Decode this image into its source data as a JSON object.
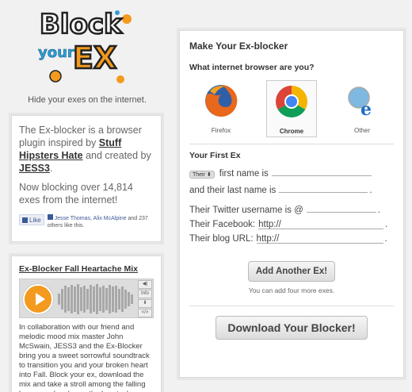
{
  "logo": {
    "line1": "Block",
    "line2": "your",
    "line3": "EX"
  },
  "tagline": "Hide your exes on the internet.",
  "info": {
    "text_before": "The Ex-blocker is a browser plugin inspired by ",
    "link1": "Stuff Hipsters Hate",
    "text_mid": " and created by ",
    "link2": "JESS3",
    "text_after": ".",
    "blocking_before": "Now blocking over ",
    "blocking_count": "14,814",
    "blocking_after": " exes from the internet!",
    "like_label": "Like",
    "like_names": "Jesse Thomas, Alix McAlpine",
    "like_rest": " and 237 others like this."
  },
  "mix": {
    "title": "Ex-Blocker Fall Heartache Mix",
    "ctrl_info": "Info",
    "ctrl_embed": "</>",
    "text": "In collaboration with our friend and melodic mood mix master John McSwain, JESS3 and the Ex-Blocker bring you a sweet sorrowful soundtrack to transition you and your broken heart into Fall. Block your ex, download the mix and take a stroll among the falling leaves and embrace the heartache."
  },
  "panel": {
    "title": "Make Your Ex-blocker",
    "browser_question": "What internet browser are you?",
    "browsers": [
      {
        "name": "Firefox",
        "selected": false
      },
      {
        "name": "Chrome",
        "selected": true
      },
      {
        "name": "Other",
        "selected": false
      }
    ],
    "first_ex": "Your First Ex",
    "pronoun": "Their",
    "first_name": "first name is",
    "last_name": "and their last name is",
    "twitter": "Their Twitter username is @",
    "facebook": "Their Facebook:",
    "facebook_value": "http://",
    "blog": "Their blog URL:",
    "blog_value": "http://",
    "add_button": "Add Another Ex!",
    "add_hint": "You can add four more exes.",
    "download_button": "Download Your Blocker!"
  },
  "colors": {
    "orange": "#f39a1f",
    "chrome_red": "#db4437",
    "chrome_green": "#0f9d58",
    "chrome_yellow": "#f4b400",
    "chrome_blue": "#4285f4"
  }
}
